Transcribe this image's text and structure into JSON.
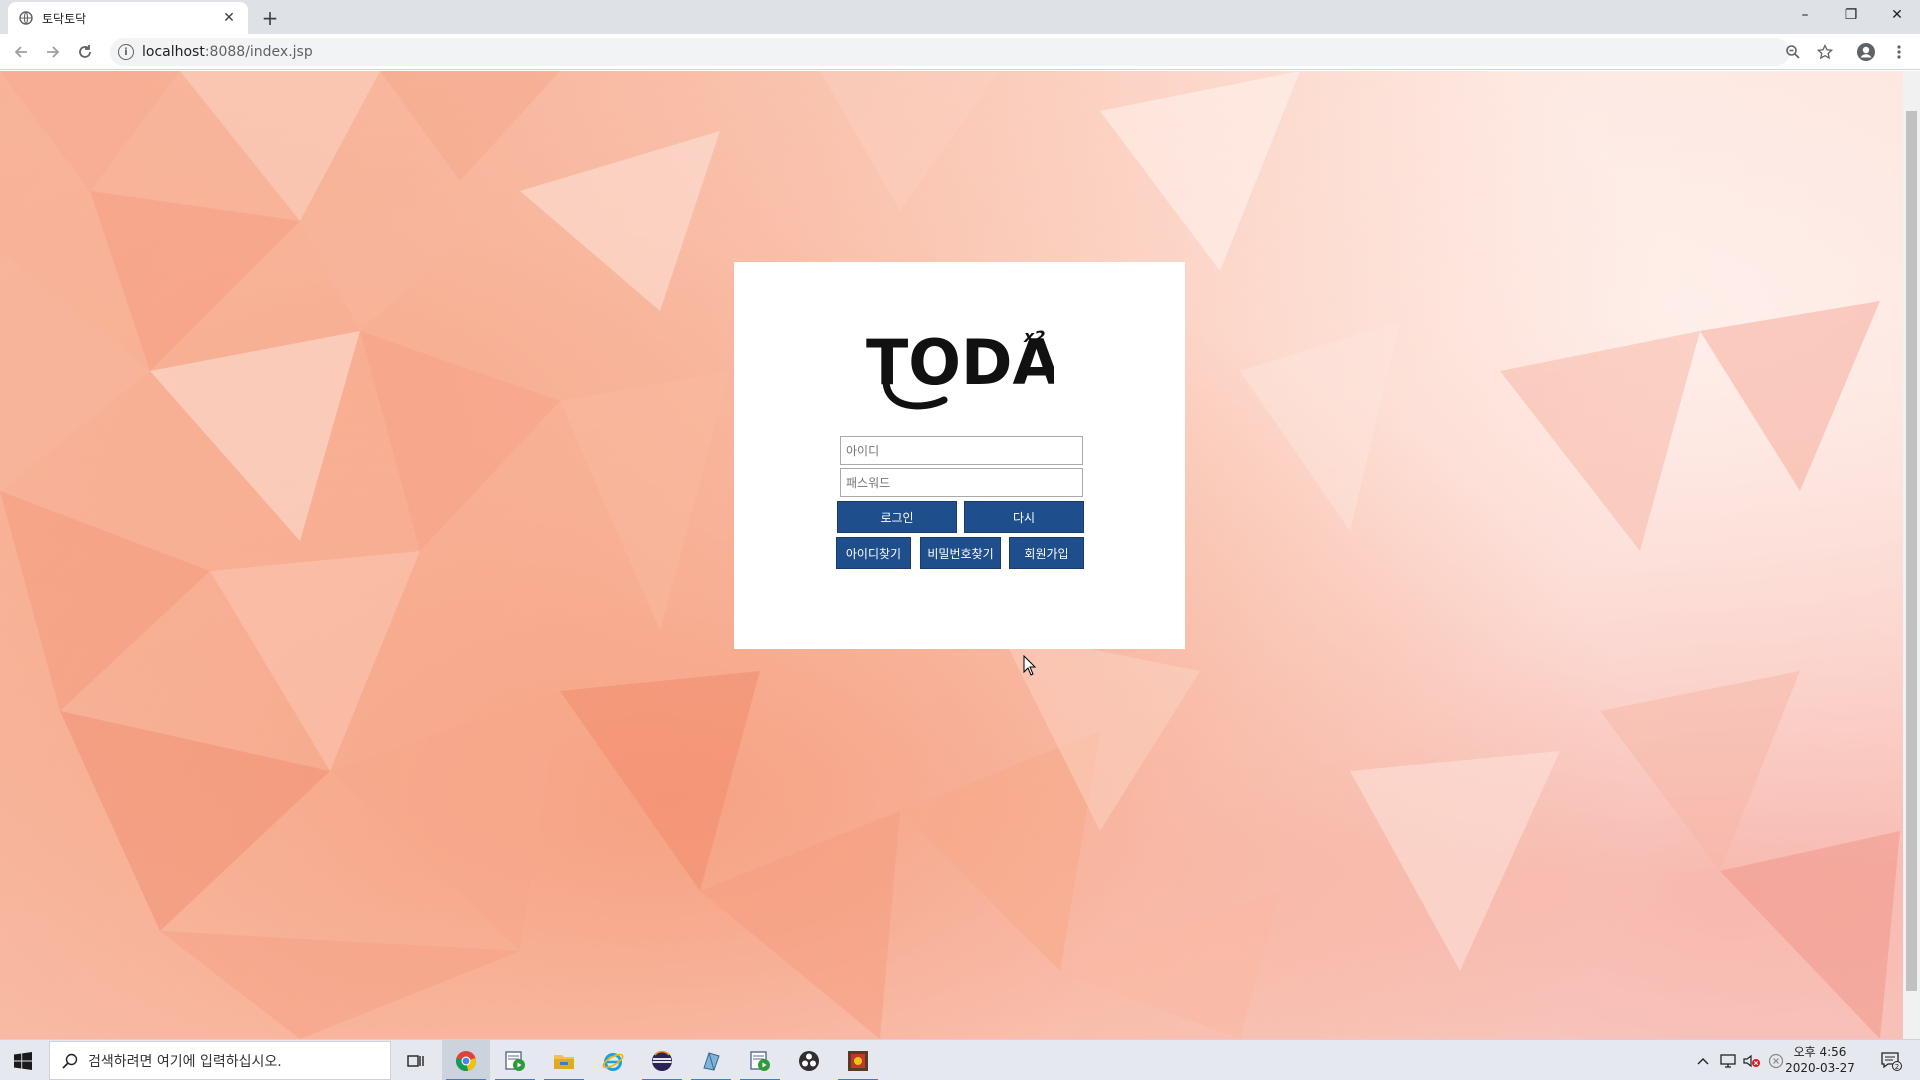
{
  "browser": {
    "tab_title": "토닥토닥",
    "new_tab": "+",
    "url_host": "localhost",
    "url_path": ":8088/index.jsp",
    "window_controls": {
      "minimize": "–",
      "restore": "❐",
      "close": "✕"
    }
  },
  "login": {
    "logo_text": "TODAK",
    "logo_superscript": "x2",
    "id_placeholder": "아이디",
    "password_placeholder": "패스워드",
    "login_button": "로그인",
    "reset_button": "다시",
    "find_id_button": "아이디찾기",
    "find_password_button": "비밀번호찾기",
    "signup_button": "회원가입"
  },
  "taskbar": {
    "search_placeholder": "검색하려면 여기에 입력하십시오.",
    "clock_period_time": "오후 4:56",
    "clock_date": "2020-03-27",
    "notification_count": "2"
  },
  "colors": {
    "button_bg": "#1f4e8c",
    "background_peach": "#f7b8a0"
  }
}
